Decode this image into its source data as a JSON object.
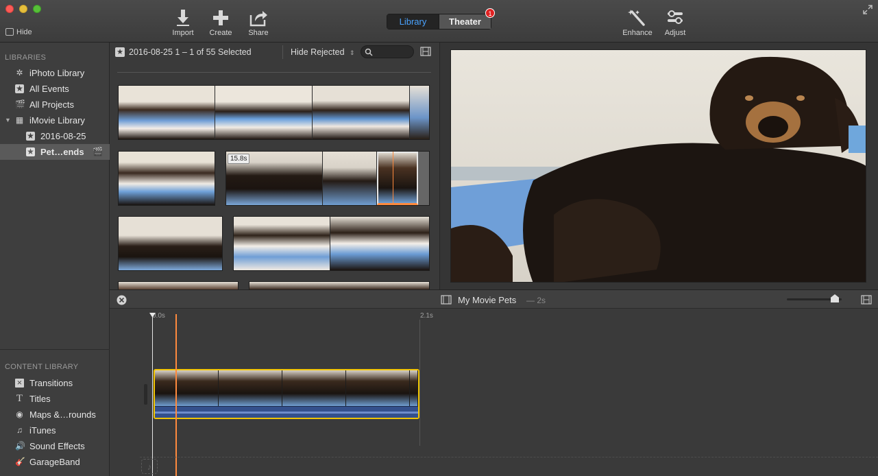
{
  "window": {
    "title": "iMovie"
  },
  "toolbar": {
    "hide_label": "Hide",
    "import_label": "Import",
    "create_label": "Create",
    "share_label": "Share",
    "library_tab": "Library",
    "theater_tab": "Theater",
    "theater_badge": "1",
    "enhance_label": "Enhance",
    "adjust_label": "Adjust",
    "accent_color": "#4aa3ff",
    "badge_color": "#e02020"
  },
  "sidebar": {
    "libraries_header": "LIBRARIES",
    "items": [
      {
        "label": "iPhoto Library",
        "icon": "iphoto-icon"
      },
      {
        "label": "All Events",
        "icon": "star-icon"
      },
      {
        "label": "All Projects",
        "icon": "clapper-icon"
      },
      {
        "label": "iMovie Library",
        "icon": "grid-icon"
      },
      {
        "label": "2016-08-25",
        "icon": "star-icon"
      },
      {
        "label": "Pet…ends",
        "icon": "star-icon"
      }
    ],
    "content_header": "CONTENT LIBRARY",
    "content_items": [
      {
        "label": "Transitions",
        "icon": "transitions-icon"
      },
      {
        "label": "Titles",
        "icon": "titles-icon"
      },
      {
        "label": "Maps &…rounds",
        "icon": "globe-icon"
      },
      {
        "label": "iTunes",
        "icon": "music-note-icon"
      },
      {
        "label": "Sound Effects",
        "icon": "speaker-icon"
      },
      {
        "label": "GarageBand",
        "icon": "guitar-icon"
      }
    ]
  },
  "browser": {
    "event_label": "2016-08-25 1 – 1 of 55 Selected",
    "filter_label": "Hide Rejected",
    "search_placeholder": "",
    "clip_duration_badge": "15.8s"
  },
  "timeline": {
    "project_title": "My Movie Pets",
    "project_duration": "— 2s",
    "ruler_start": "0.0s",
    "ruler_end": "2.1s",
    "clip_border_color": "#f2c500",
    "playhead_color": "#ff8a3d"
  }
}
